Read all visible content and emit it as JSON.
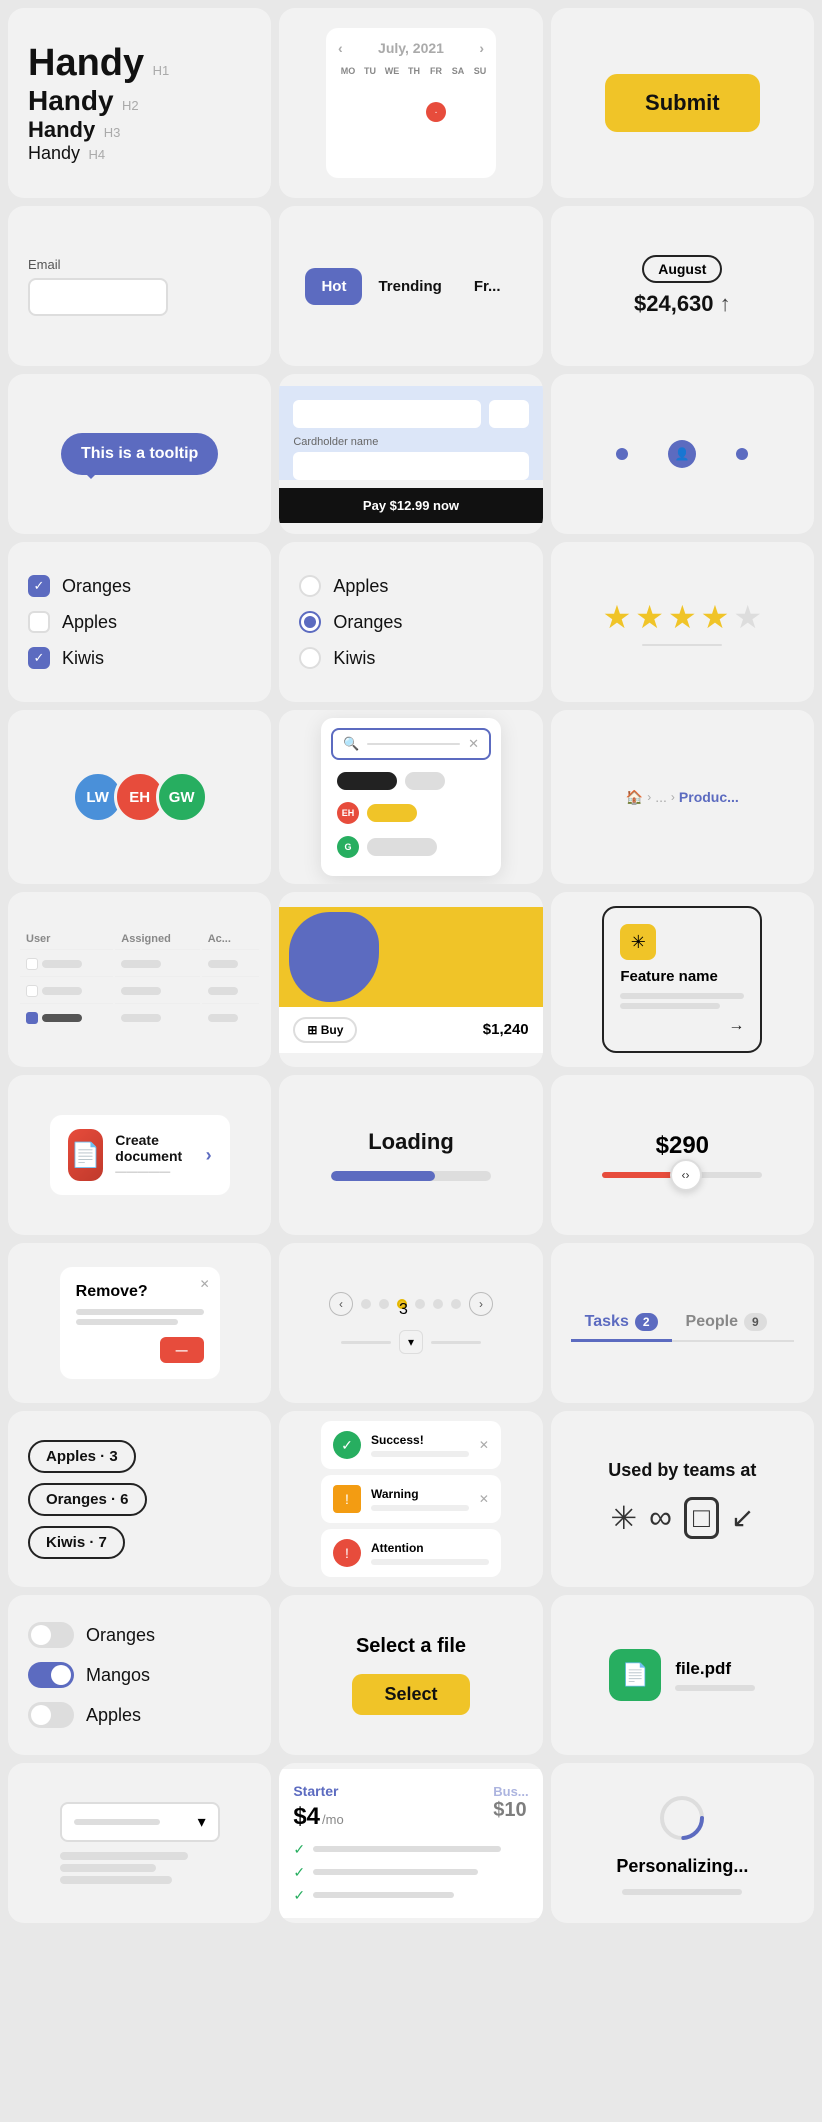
{
  "cards": {
    "typography": {
      "h1_text": "Handy",
      "h1_label": "H1",
      "h2_text": "Handy",
      "h2_label": "H2",
      "h3_text": "Handy",
      "h3_label": "H3",
      "h4_text": "Handy",
      "h4_label": "H4"
    },
    "calendar": {
      "month": "July, 2021",
      "days_header": [
        "MO",
        "TU",
        "WE",
        "TH",
        "FR",
        "SA",
        "SU"
      ],
      "today_day": "14"
    },
    "submit": {
      "label": "Submit"
    },
    "email": {
      "label": "Email",
      "placeholder": ""
    },
    "tabs": {
      "items": [
        "Hot",
        "Trending",
        "Fr..."
      ],
      "active": 0
    },
    "stats": {
      "month": "August",
      "value": "$24,630",
      "arrow": "↑"
    },
    "tooltip": {
      "text": "This is a tooltip"
    },
    "payment": {
      "field_label": "Cardholder name",
      "button_text": "Pay $12.99 now"
    },
    "checkboxes": {
      "items": [
        {
          "label": "Oranges",
          "checked": true
        },
        {
          "label": "Apples",
          "checked": false
        },
        {
          "label": "Kiwis",
          "checked": true
        }
      ]
    },
    "radios": {
      "items": [
        {
          "label": "Apples",
          "checked": false
        },
        {
          "label": "Oranges",
          "checked": true
        },
        {
          "label": "Kiwis",
          "checked": false
        }
      ]
    },
    "stars": {
      "filled": 4,
      "total": 5
    },
    "avatars": {
      "items": [
        {
          "initials": "LW",
          "color": "#4a90d9"
        },
        {
          "initials": "EH",
          "color": "#e74c3c"
        },
        {
          "initials": "GW",
          "color": "#27ae60"
        }
      ]
    },
    "command": {
      "placeholder": "—"
    },
    "breadcrumb": {
      "home": "🏠",
      "separator": ">",
      "dots": "...",
      "current": "Produc..."
    },
    "table": {
      "headers": [
        "User",
        "Assigned",
        "Ac..."
      ]
    },
    "product": {
      "buy_label": "⊞ Buy",
      "price": "$1,240"
    },
    "feature": {
      "name": "Feature name",
      "arrow": "→"
    },
    "app_icon": {
      "label": "Create document",
      "arrow": "›"
    },
    "loading": {
      "text": "Loading",
      "progress": 65
    },
    "price_slider": {
      "value": "$290"
    },
    "dialog": {
      "title": "Remove?",
      "button": "—"
    },
    "pagination": {
      "dots": [
        1,
        2,
        3,
        4,
        5,
        6
      ],
      "active_dot": 3
    },
    "tabs_count": {
      "items": [
        {
          "label": "Tasks",
          "count": 2,
          "active": true
        },
        {
          "label": "People",
          "count": 9,
          "active": false
        }
      ]
    },
    "tags": {
      "items": [
        {
          "label": "Apples · 3"
        },
        {
          "label": "Oranges · 6"
        },
        {
          "label": "Kiwis · 7"
        }
      ]
    },
    "notifications": {
      "items": [
        {
          "type": "success",
          "title": "Success!"
        },
        {
          "type": "warning",
          "title": "Warning"
        },
        {
          "type": "error",
          "title": "Attention"
        }
      ]
    },
    "teams": {
      "title": "Used by teams at",
      "logos": [
        "✳",
        "∞",
        "□",
        "↙"
      ]
    },
    "toggles": {
      "items": [
        {
          "label": "Oranges",
          "on": false
        },
        {
          "label": "Mangos",
          "on": true
        },
        {
          "label": "Apples",
          "on": false
        }
      ]
    },
    "file_select": {
      "title": "Select a file",
      "button": "Select"
    },
    "file_item": {
      "name": "file.pdf"
    },
    "pricing": {
      "plan": "Starter",
      "amount": "$4",
      "period": "/mo"
    },
    "personalizing": {
      "text": "Personalizing..."
    }
  },
  "colors": {
    "primary": "#5c6bc0",
    "yellow": "#f0c428",
    "red": "#e74c3c",
    "green": "#27ae60"
  }
}
